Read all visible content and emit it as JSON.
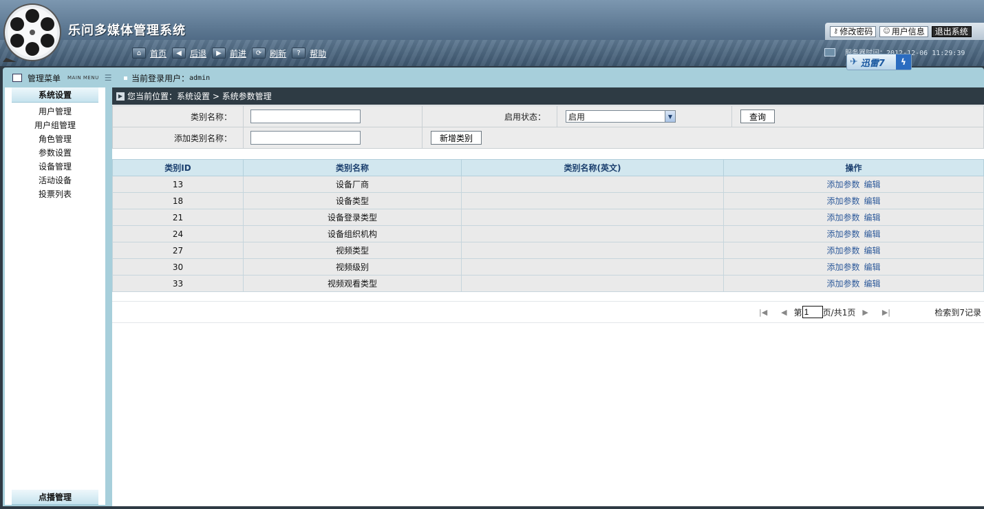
{
  "app": {
    "title": "乐问多媒体管理系统"
  },
  "nav": [
    {
      "label": "首页",
      "icon": "home-icon"
    },
    {
      "label": "后退",
      "icon": "back-arrow-icon"
    },
    {
      "label": "前进",
      "icon": "forward-arrow-icon"
    },
    {
      "label": "刷新",
      "icon": "refresh-icon"
    },
    {
      "label": "帮助",
      "icon": "help-icon"
    }
  ],
  "top_buttons": {
    "change_password": "修改密码",
    "user_info": "用户信息",
    "logout": "退出系统"
  },
  "server_time": "服务器时间：2012-12-06 11:29:39",
  "xunlei": {
    "text": "迅雷7"
  },
  "menu_header": {
    "title": "管理菜单",
    "subtitle": "MAIN MENU"
  },
  "login": {
    "label": "当前登录用户：",
    "user": "admin"
  },
  "sidebar": {
    "section_title": "系统设置",
    "items": [
      "用户管理",
      "用户组管理",
      "角色管理",
      "参数设置",
      "设备管理",
      "活动设备",
      "投票列表"
    ],
    "bottom_section": "点播管理"
  },
  "breadcrumb": "您当前位置：系统设置 > 系统参数管理",
  "search": {
    "category_name_label": "类别名称：",
    "category_name_value": "",
    "status_label": "启用状态：",
    "status_value": "启用",
    "query_button": "查询",
    "add_name_label": "添加类别名称：",
    "add_name_value": "",
    "add_button": "新增类别"
  },
  "table": {
    "headers": [
      "类别ID",
      "类别名称",
      "类别名称(英文)",
      "操作"
    ],
    "rows": [
      {
        "id": "13",
        "name": "设备厂商",
        "name_en": ""
      },
      {
        "id": "18",
        "name": "设备类型",
        "name_en": ""
      },
      {
        "id": "21",
        "name": "设备登录类型",
        "name_en": ""
      },
      {
        "id": "24",
        "name": "设备组织机构",
        "name_en": ""
      },
      {
        "id": "27",
        "name": "视频类型",
        "name_en": ""
      },
      {
        "id": "30",
        "name": "视频级别",
        "name_en": ""
      },
      {
        "id": "33",
        "name": "视频观看类型",
        "name_en": ""
      }
    ],
    "action_add_param": "添加参数",
    "action_edit": "编辑"
  },
  "pager": {
    "prefix": "第",
    "current_page": "1",
    "suffix": "页/共1页",
    "total_records": "检索到7记录"
  },
  "colors": {
    "header_bg": "#5b7690",
    "frame_bg": "#a7cfdb",
    "breadcrumb_bg": "#2e3b44",
    "table_header_bg": "#d2e7ef",
    "link": "#2e5a9a"
  }
}
